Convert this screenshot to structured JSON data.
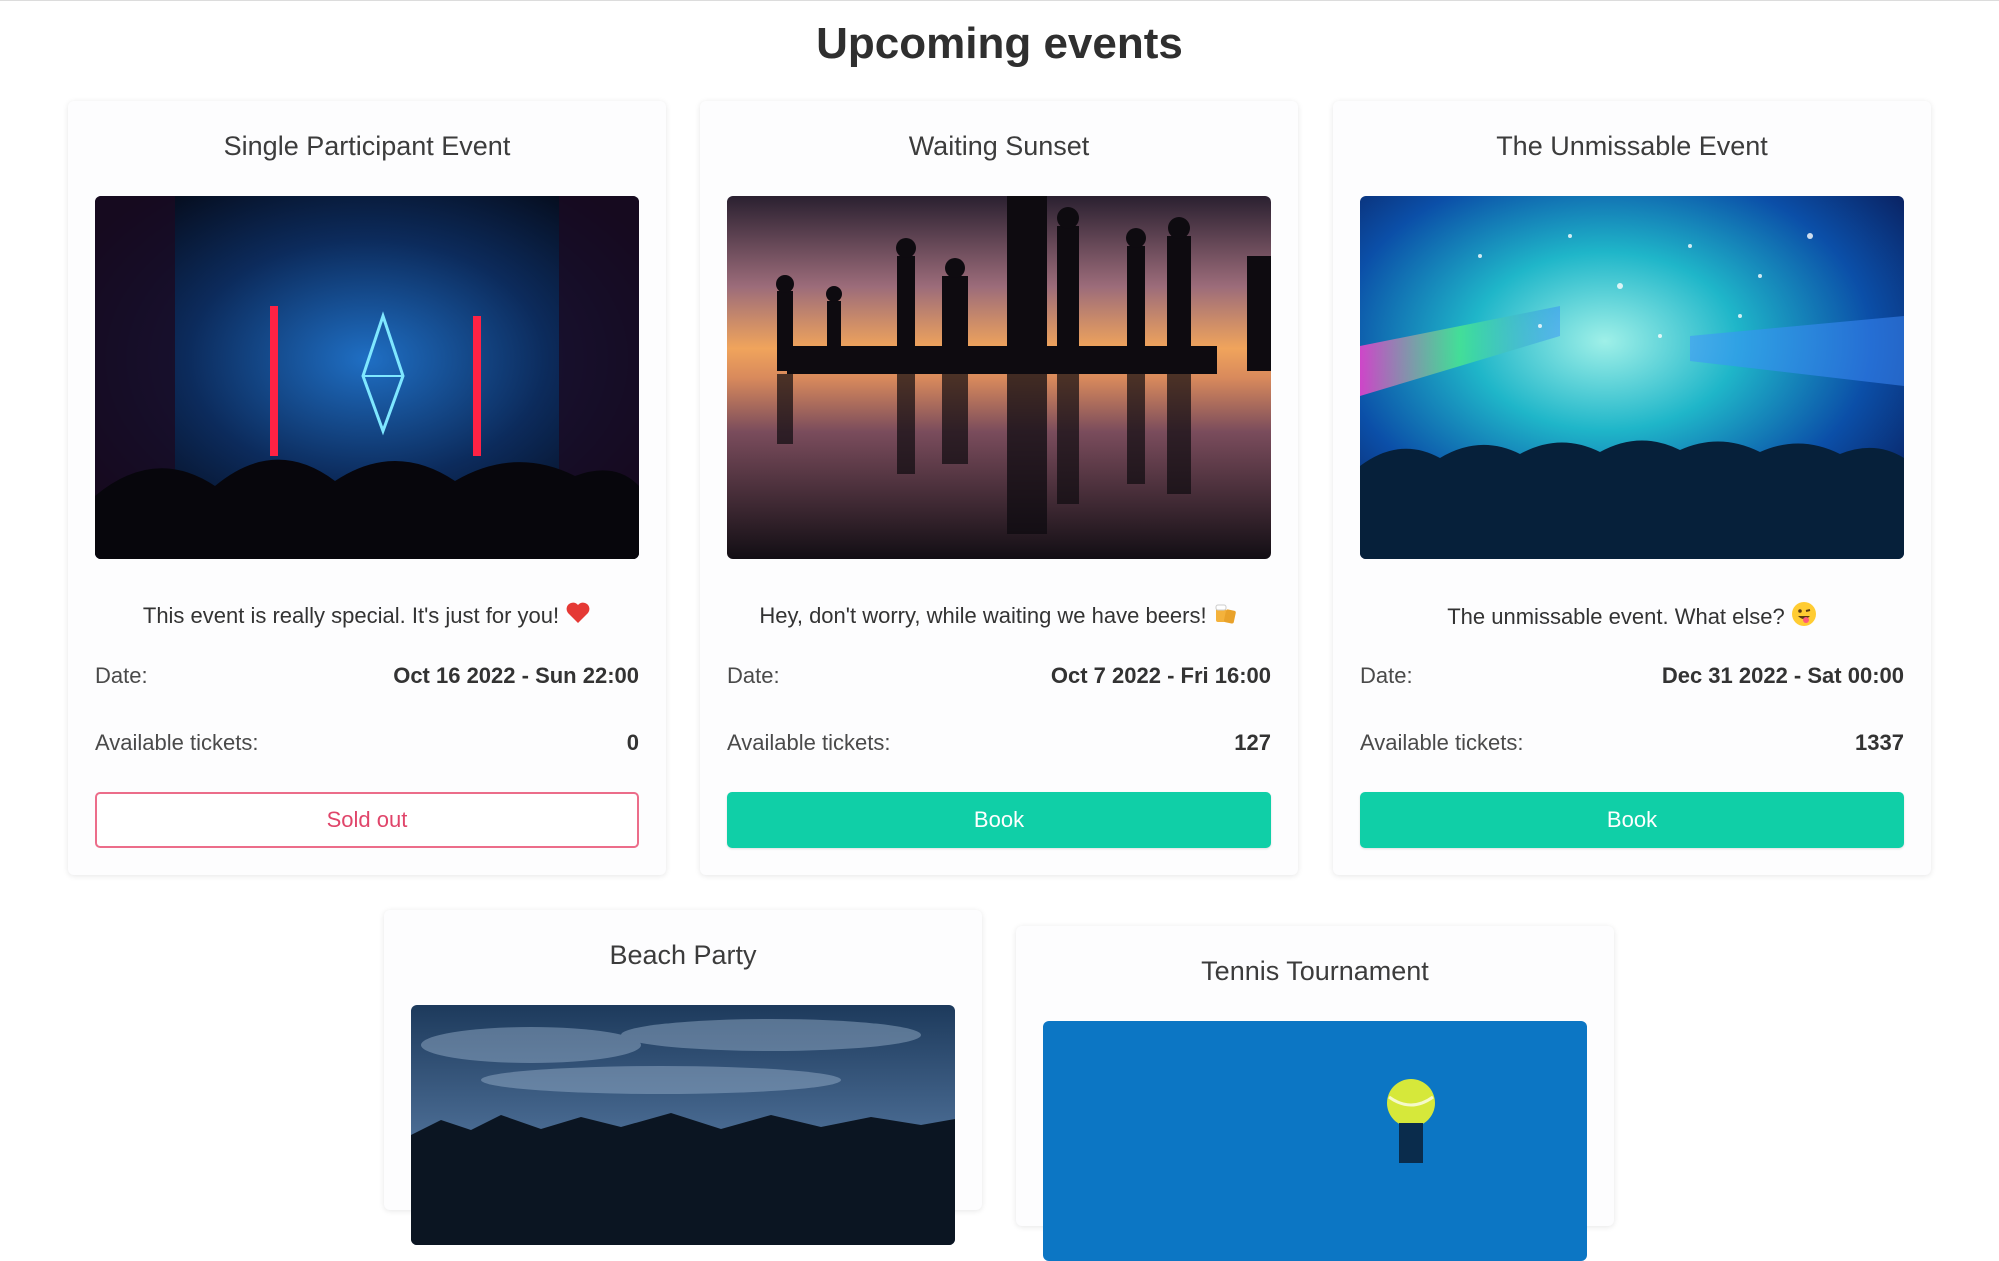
{
  "page": {
    "title": "Upcoming events"
  },
  "events": [
    {
      "title": "Single Participant Event",
      "image": "neon-diamond-concert-image",
      "description": "This event is really special. It's just for you!",
      "emoji": "heart-emoji",
      "date_label": "Date:",
      "date_value": "Oct 16 2022 - Sun 22:00",
      "tickets_label": "Available tickets:",
      "tickets_value": "0",
      "button_label": "Sold out",
      "button_state": "sold-out"
    },
    {
      "title": "Waiting Sunset",
      "image": "sunset-silhouettes-image",
      "description": "Hey, don't worry, while waiting we have beers!",
      "emoji": "beer-mugs-emoji",
      "date_label": "Date:",
      "date_value": "Oct 7 2022 - Fri 16:00",
      "tickets_label": "Available tickets:",
      "tickets_value": "127",
      "button_label": "Book",
      "button_state": "available"
    },
    {
      "title": "The Unmissable Event",
      "image": "festival-lights-crowd-image",
      "description": "The unmissable event. What else?",
      "emoji": "winking-tongue-emoji",
      "date_label": "Date:",
      "date_value": "Dec 31 2022 - Sat 00:00",
      "tickets_label": "Available tickets:",
      "tickets_value": "1337",
      "button_label": "Book",
      "button_state": "available"
    },
    {
      "title": "Beach Party",
      "image": "cloudy-beach-palms-image"
    },
    {
      "title": "Tennis Tournament",
      "image": "tennis-ball-blue-image"
    }
  ],
  "colors": {
    "book_button": "#10cfa7",
    "sold_out_border": "#ec6d8a",
    "sold_out_text": "#e0456a"
  }
}
